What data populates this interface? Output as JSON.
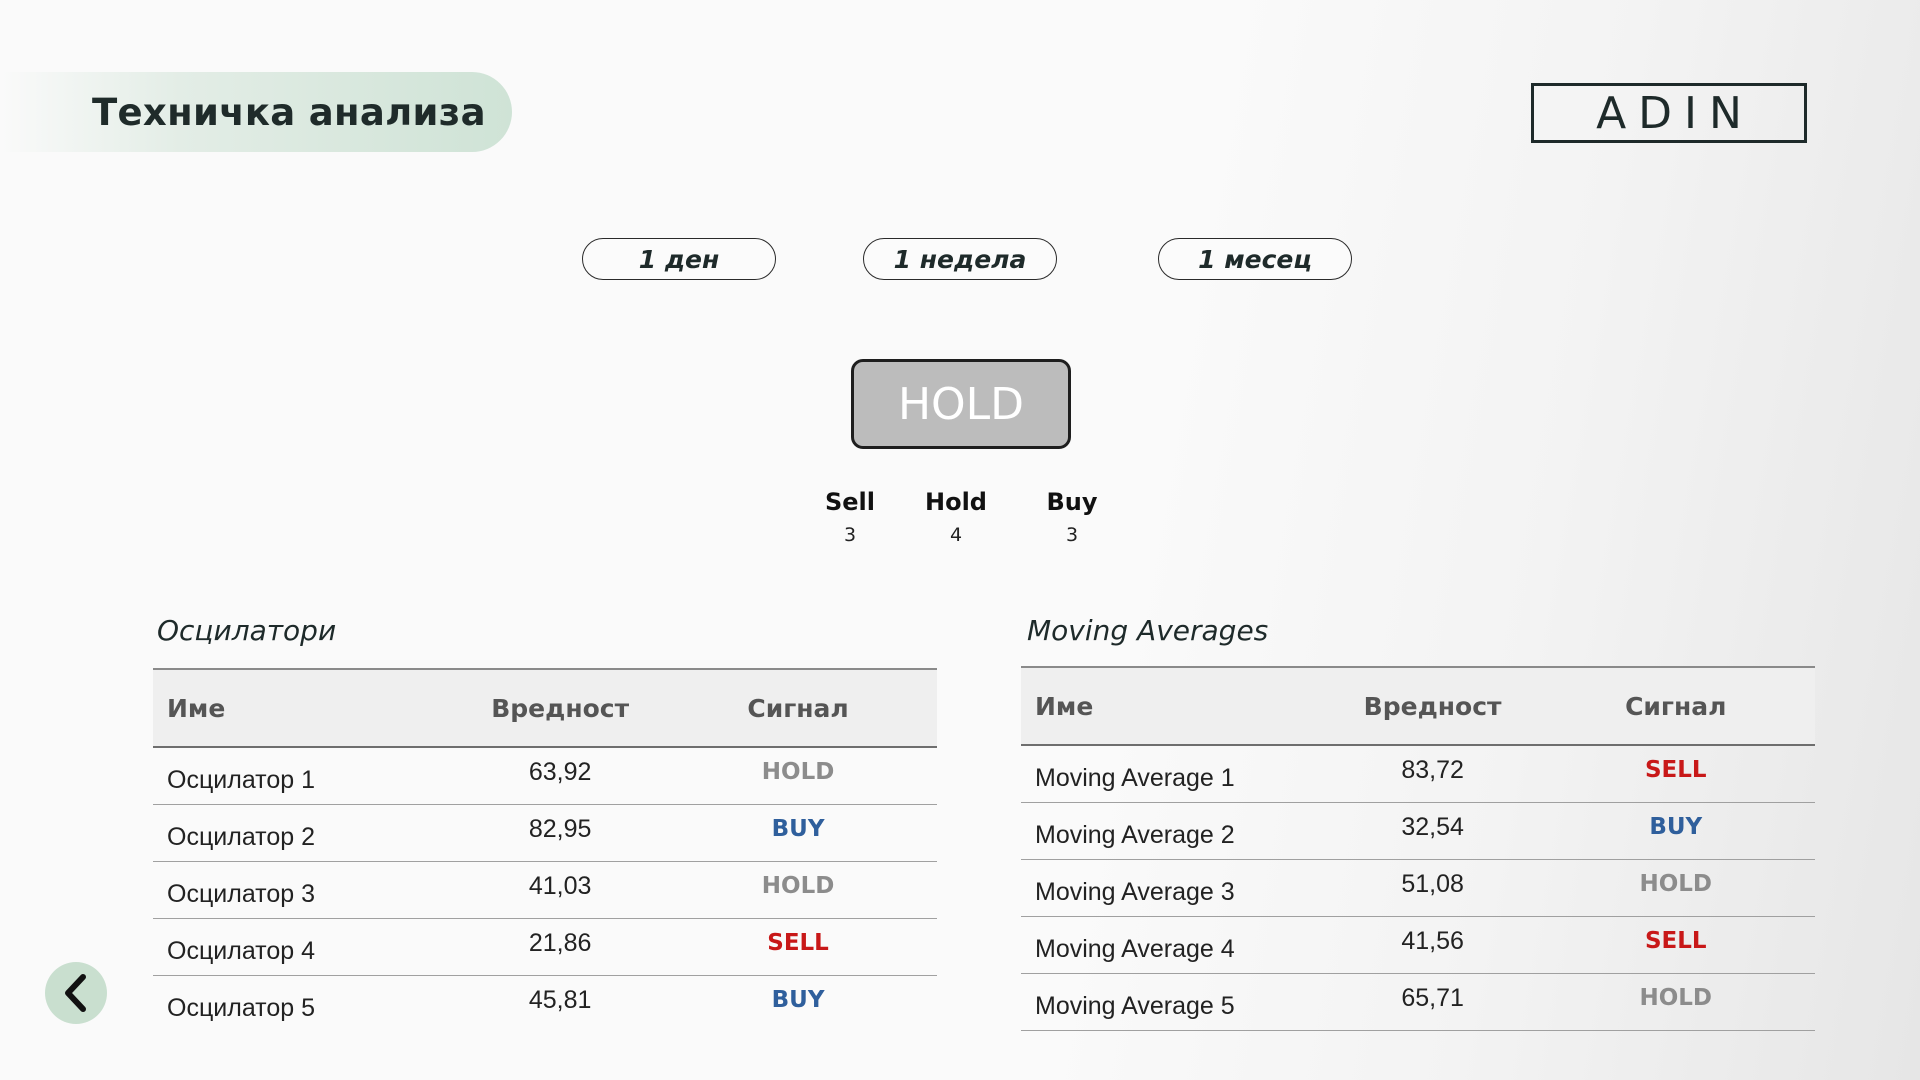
{
  "header": {
    "title": "Техничка анализа",
    "logo": "ADIN"
  },
  "periods": [
    {
      "label": "1 ден"
    },
    {
      "label": "1 недела"
    },
    {
      "label": "1 месец"
    }
  ],
  "summary": {
    "signal": "HOLD",
    "counts": [
      {
        "label": "Sell",
        "value": "3"
      },
      {
        "label": "Hold",
        "value": "4"
      },
      {
        "label": "Buy",
        "value": "3"
      }
    ]
  },
  "oscillators": {
    "title": "Осцилатори",
    "columns": [
      "Име",
      "Вредност",
      "Сигнал"
    ],
    "rows": [
      {
        "name": "Осцилатор 1",
        "value": "63,92",
        "signal": "HOLD"
      },
      {
        "name": "Осцилатор 2",
        "value": "82,95",
        "signal": "BUY"
      },
      {
        "name": "Осцилатор 3",
        "value": "41,03",
        "signal": "HOLD"
      },
      {
        "name": "Осцилатор 4",
        "value": "21,86",
        "signal": "SELL"
      },
      {
        "name": "Осцилатор 5",
        "value": "45,81",
        "signal": "BUY"
      }
    ]
  },
  "moving_averages": {
    "title": "Moving Averages",
    "columns": [
      "Име",
      "Вредност",
      "Сигнал"
    ],
    "rows": [
      {
        "name": "Moving Average 1",
        "value": "83,72",
        "signal": "SELL"
      },
      {
        "name": "Moving Average 2",
        "value": "32,54",
        "signal": "BUY"
      },
      {
        "name": "Moving Average 3",
        "value": "51,08",
        "signal": "HOLD"
      },
      {
        "name": "Moving Average 4",
        "value": "41,56",
        "signal": "SELL"
      },
      {
        "name": "Moving Average 5",
        "value": "65,71",
        "signal": "HOLD"
      }
    ]
  },
  "colors": {
    "accent_green": "#c9dfcf",
    "signal_hold": "#8c8c8c",
    "signal_buy": "#2f5f9c",
    "signal_sell": "#c81818",
    "summary_bg": "#bcbcbc"
  },
  "icons": {
    "back": "chevron-left-icon"
  }
}
